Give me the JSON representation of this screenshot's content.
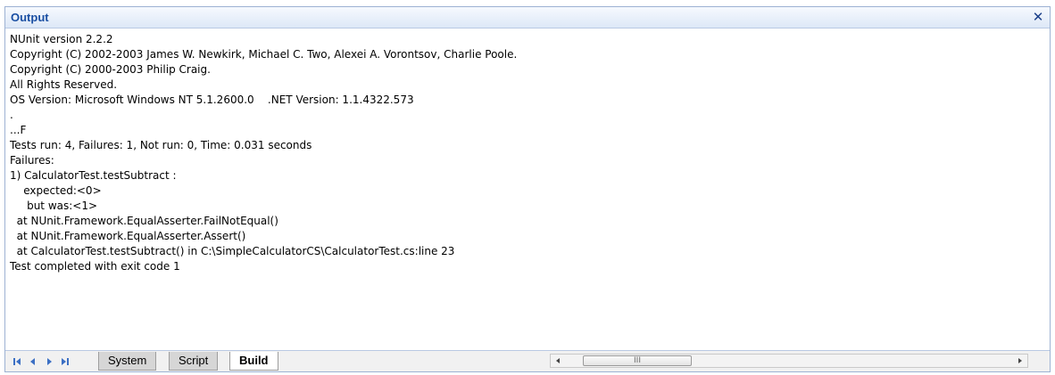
{
  "window": {
    "title": "Output",
    "close_glyph": "✕"
  },
  "output_lines": [
    "NUnit version 2.2.2",
    "Copyright (C) 2002-2003 James W. Newkirk, Michael C. Two, Alexei A. Vorontsov, Charlie Poole.",
    "Copyright (C) 2000-2003 Philip Craig.",
    "All Rights Reserved.",
    "OS Version: Microsoft Windows NT 5.1.2600.0    .NET Version: 1.1.4322.573",
    ".",
    "...F",
    "Tests run: 4, Failures: 1, Not run: 0, Time: 0.031 seconds",
    "Failures:",
    "1) CalculatorTest.testSubtract :",
    "    expected:<0>",
    "     but was:<1>",
    "  at NUnit.Framework.EqualAsserter.FailNotEqual()",
    "  at NUnit.Framework.EqualAsserter.Assert()",
    "  at CalculatorTest.testSubtract() in C:\\SimpleCalculatorCS\\CalculatorTest.cs:line 23",
    "Test completed with exit code 1"
  ],
  "tabs": [
    {
      "label": "System",
      "active": false
    },
    {
      "label": "Script",
      "active": false
    },
    {
      "label": "Build",
      "active": true
    }
  ],
  "scrollbar": {
    "grip": "III"
  },
  "icons": {
    "nav": [
      "first-icon",
      "prev-icon",
      "next-icon",
      "last-icon"
    ],
    "close": "close-icon"
  },
  "colors": {
    "title_text": "#1a4fa3",
    "nav_arrows": "#3b6fc4",
    "border": "#9db2d3"
  }
}
